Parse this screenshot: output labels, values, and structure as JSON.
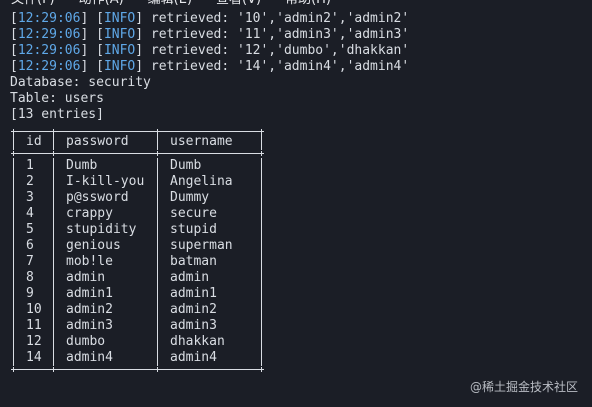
{
  "menu": [
    "文件(F)",
    "动作(A)",
    "编辑(E)",
    "查看(V)",
    "帮助(H)"
  ],
  "log": [
    {
      "time": "12:29:06",
      "level": "INFO",
      "msg": " retrieved: '10','admin2','admin2'"
    },
    {
      "time": "12:29:06",
      "level": "INFO",
      "msg": " retrieved: '11','admin3','admin3'"
    },
    {
      "time": "12:29:06",
      "level": "INFO",
      "msg": " retrieved: '12','dumbo','dhakkan'"
    },
    {
      "time": "12:29:06",
      "level": "INFO",
      "msg": " retrieved: '14','admin4','admin4'"
    }
  ],
  "database_line": "Database: security",
  "table_line": "Table: users",
  "entries_line": "[13 entries]",
  "table": {
    "headers": [
      "id",
      "password",
      "username"
    ],
    "rows": [
      [
        "1",
        "Dumb",
        "Dumb"
      ],
      [
        "2",
        "I-kill-you",
        "Angelina"
      ],
      [
        "3",
        "p@ssword",
        "Dummy"
      ],
      [
        "4",
        "crappy",
        "secure"
      ],
      [
        "5",
        "stupidity",
        "stupid"
      ],
      [
        "6",
        "genious",
        "superman"
      ],
      [
        "7",
        "mob!le",
        "batman"
      ],
      [
        "8",
        "admin",
        "admin"
      ],
      [
        "9",
        "admin1",
        "admin1"
      ],
      [
        "10",
        "admin2",
        "admin2"
      ],
      [
        "11",
        "admin3",
        "admin3"
      ],
      [
        "12",
        "dumbo",
        "dhakkan"
      ],
      [
        "14",
        "admin4",
        "admin4"
      ]
    ]
  },
  "watermark": "@稀土掘金技术社区",
  "colors": {
    "background": "#1b1e26",
    "text": "#d9dde3",
    "accent": "#5fa8e8"
  }
}
